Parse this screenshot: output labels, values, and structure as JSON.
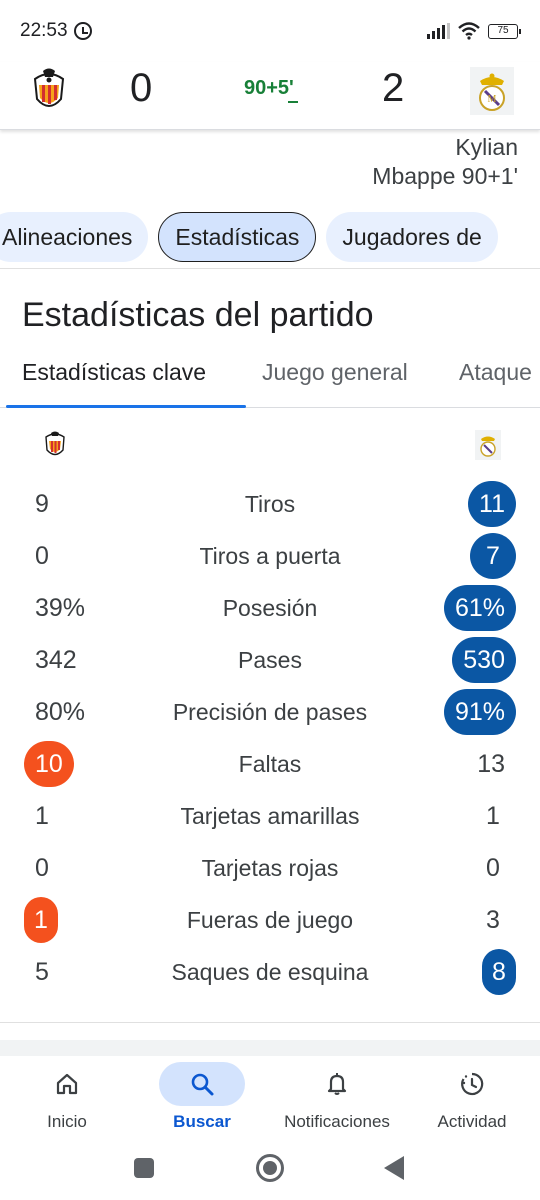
{
  "status_bar": {
    "time": "22:53",
    "battery": "75"
  },
  "match": {
    "home_score": "0",
    "away_score": "2",
    "clock": "90+5'",
    "scorer_line1": "Kylian",
    "scorer_line2": "Mbappe 90+1'"
  },
  "chips": [
    {
      "label": "Alineaciones",
      "active": false
    },
    {
      "label": "Estadísticas",
      "active": true
    },
    {
      "label": "Jugadores de",
      "active": false
    }
  ],
  "section_title": "Estadísticas del partido",
  "subtabs": [
    {
      "label": "Estadísticas clave",
      "active": true
    },
    {
      "label": "Juego general",
      "active": false
    },
    {
      "label": "Ataque",
      "active": false
    }
  ],
  "stats": [
    {
      "label": "Tiros",
      "home": "9",
      "away": "11",
      "leader": "away"
    },
    {
      "label": "Tiros a puerta",
      "home": "0",
      "away": "7",
      "leader": "away"
    },
    {
      "label": "Posesión",
      "home": "39%",
      "away": "61%",
      "leader": "away"
    },
    {
      "label": "Pases",
      "home": "342",
      "away": "530",
      "leader": "away"
    },
    {
      "label": "Precisión de pases",
      "home": "80%",
      "away": "91%",
      "leader": "away"
    },
    {
      "label": "Faltas",
      "home": "10",
      "away": "13",
      "leader": "home"
    },
    {
      "label": "Tarjetas amarillas",
      "home": "1",
      "away": "1",
      "leader": "none"
    },
    {
      "label": "Tarjetas rojas",
      "home": "0",
      "away": "0",
      "leader": "none"
    },
    {
      "label": "Fueras de juego",
      "home": "1",
      "away": "3",
      "leader": "home"
    },
    {
      "label": "Saques de esquina",
      "home": "5",
      "away": "8",
      "leader": "away"
    }
  ],
  "bottom_nav": [
    {
      "label": "Inicio",
      "icon": "home-icon",
      "active": false
    },
    {
      "label": "Buscar",
      "icon": "search-icon",
      "active": true
    },
    {
      "label": "Notificaciones",
      "icon": "bell-icon",
      "active": false
    },
    {
      "label": "Actividad",
      "icon": "activity-icon",
      "active": false
    }
  ],
  "colors": {
    "home_highlight": "#f4511e",
    "away_highlight": "#0b57a4",
    "clock": "#188038",
    "nav_active": "#0b57d0"
  }
}
